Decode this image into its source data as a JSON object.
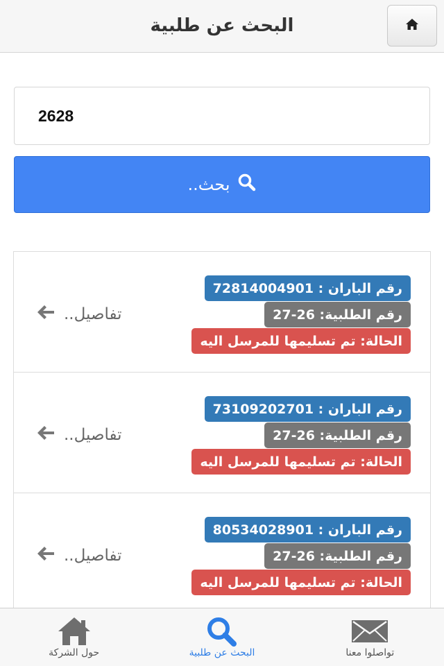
{
  "header": {
    "title": "البحث عن طلبية",
    "home_icon": "home-icon"
  },
  "search": {
    "value": "2628",
    "button_label": "بحث..",
    "button_icon": "search-icon"
  },
  "results": [
    {
      "baran_label": "رقم الباران : 72814004901",
      "order_label": "رقم الطلبية: 26-27",
      "status_label": "الحالة: تم تسليمها للمرسل اليه",
      "details_label": "تفاصيل.."
    },
    {
      "baran_label": "رقم الباران : 73109202701",
      "order_label": "رقم الطلبية: 26-27",
      "status_label": "الحالة: تم تسليمها للمرسل اليه",
      "details_label": "تفاصيل.."
    },
    {
      "baran_label": "رقم الباران : 80534028901",
      "order_label": "رقم الطلبية: 26-27",
      "status_label": "الحالة: تم تسليمها للمرسل اليه",
      "details_label": "تفاصيل.."
    }
  ],
  "tabbar": {
    "about": "حول الشركة",
    "search": "البحث عن طلبية",
    "contact": "تواصلوا معنا"
  },
  "colors": {
    "primary_button": "#4385f4",
    "tag_blue": "#337ab7",
    "tag_gray": "#777777",
    "tag_red": "#d9534f",
    "active_tab": "#2e7ee6"
  }
}
